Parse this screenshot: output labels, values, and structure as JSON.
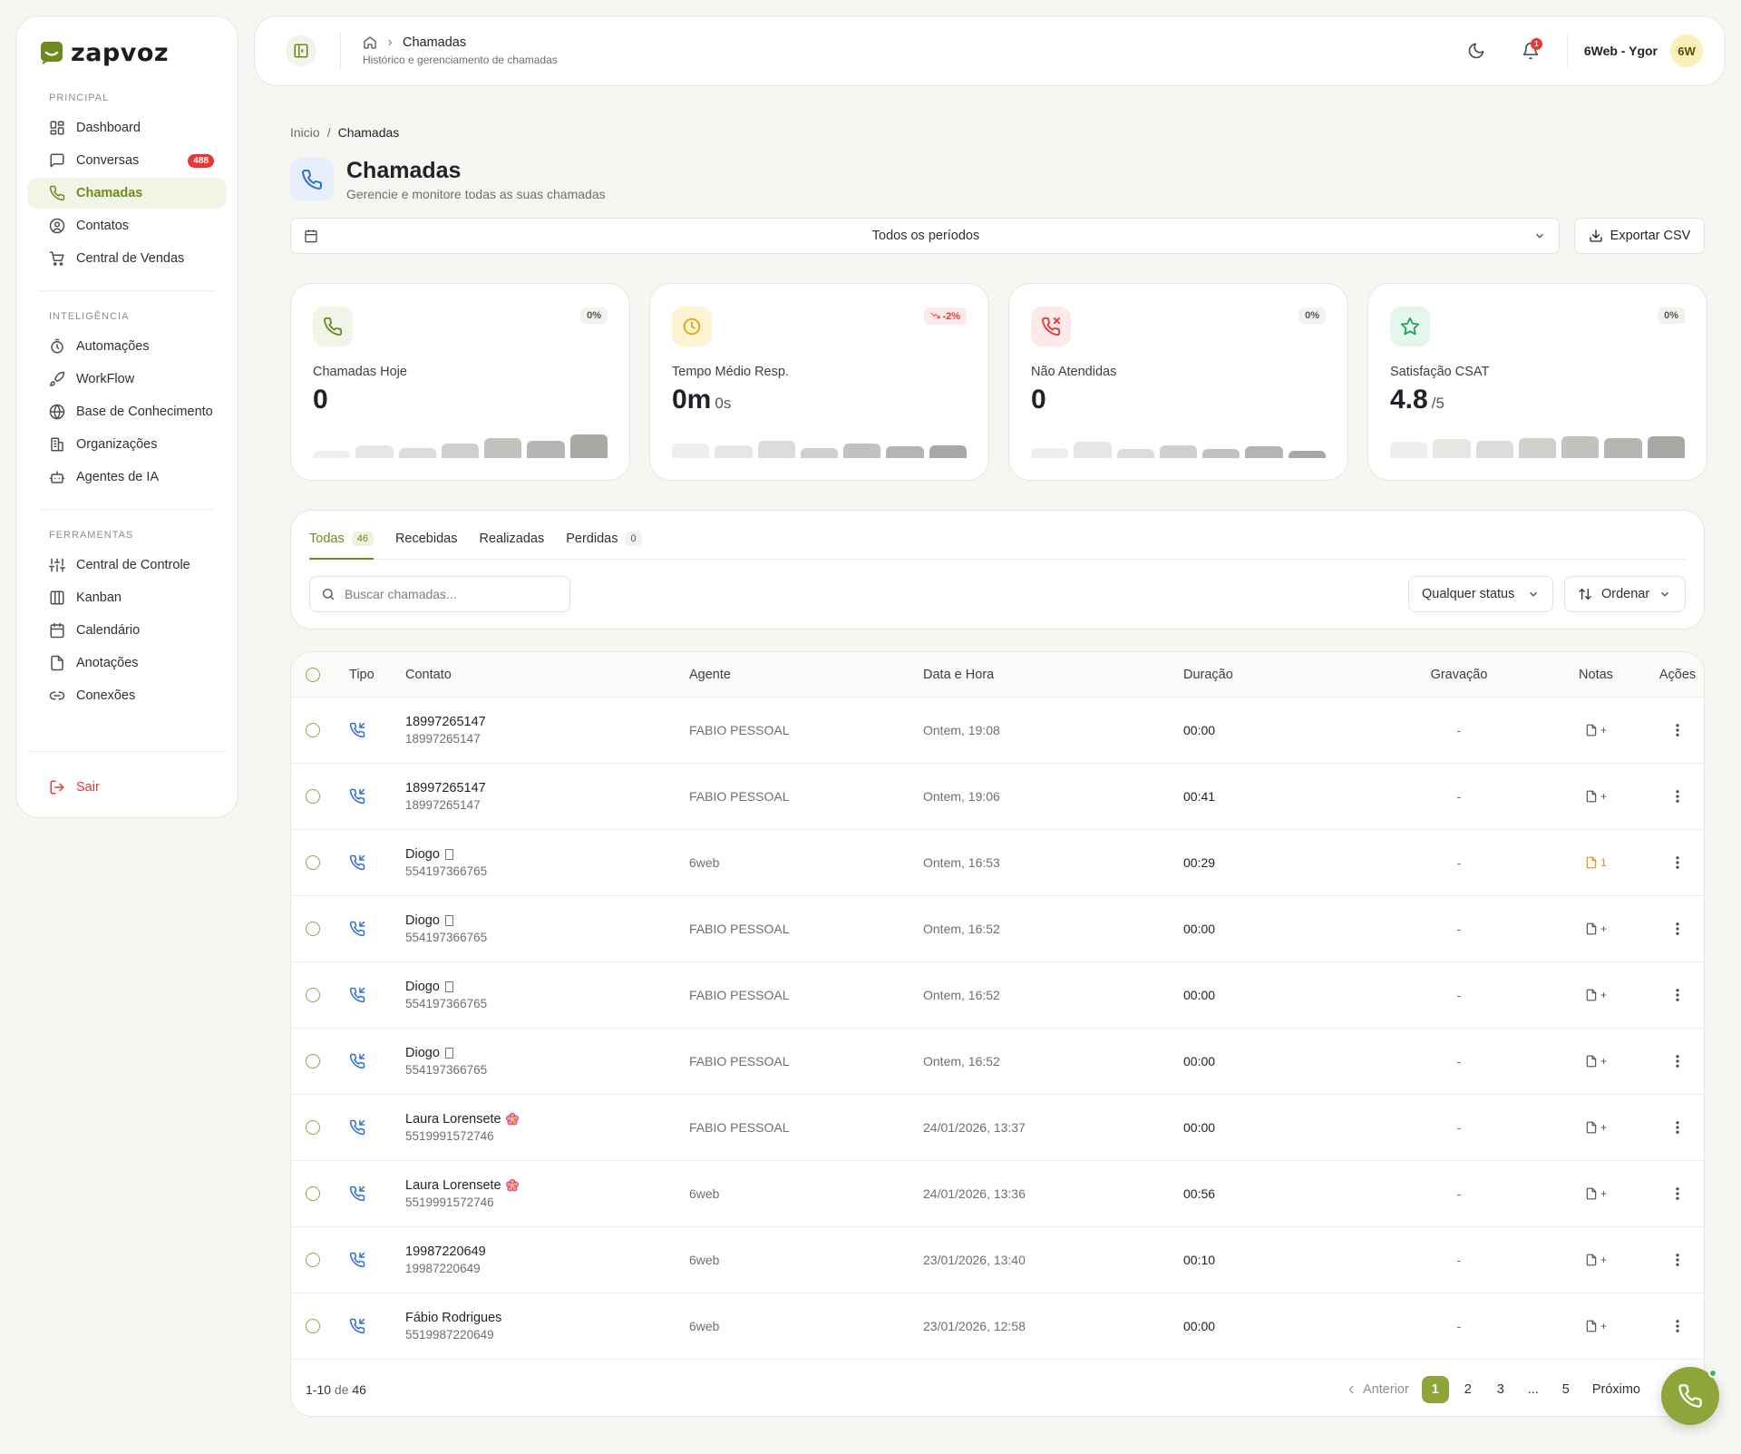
{
  "brand": {
    "name": "zapvoz",
    "color": "#6d8a1f"
  },
  "sidebar": {
    "sections": [
      {
        "label": "PRINCIPAL",
        "items": [
          {
            "label": "Dashboard",
            "icon": "dashboard-icon"
          },
          {
            "label": "Conversas",
            "icon": "chat-icon",
            "badge": "488"
          },
          {
            "label": "Chamadas",
            "icon": "phone-icon",
            "active": true
          },
          {
            "label": "Contatos",
            "icon": "user-circle-icon"
          },
          {
            "label": "Central de Vendas",
            "icon": "cart-icon"
          }
        ]
      },
      {
        "label": "INTELIGÊNCIA",
        "items": [
          {
            "label": "Automações",
            "icon": "timer-icon"
          },
          {
            "label": "WorkFlow",
            "icon": "rocket-icon"
          },
          {
            "label": "Base de Conhecimento",
            "icon": "globe-icon"
          },
          {
            "label": "Organizações",
            "icon": "building-icon"
          },
          {
            "label": "Agentes de IA",
            "icon": "bot-icon"
          }
        ]
      },
      {
        "label": "FERRAMENTAS",
        "items": [
          {
            "label": "Central de Controle",
            "icon": "sliders-icon"
          },
          {
            "label": "Kanban",
            "icon": "kanban-icon"
          },
          {
            "label": "Calendário",
            "icon": "calendar-icon"
          },
          {
            "label": "Anotações",
            "icon": "file-icon"
          },
          {
            "label": "Conexões",
            "icon": "link-icon"
          }
        ]
      }
    ],
    "logout": "Sair"
  },
  "topbar": {
    "crumb": "Chamadas",
    "subtitle": "Histórico e gerenciamento de chamadas",
    "notifications": "1",
    "user_name": "6Web - Ygor",
    "avatar": "6W"
  },
  "breadcrumb": {
    "home": "Inicio",
    "sep": "/",
    "current": "Chamadas"
  },
  "page": {
    "title": "Chamadas",
    "subtitle": "Gerencie e monitore todas as suas chamadas"
  },
  "period": {
    "value": "Todos os períodos"
  },
  "export_label": "Exportar CSV",
  "kpis": [
    {
      "label": "Chamadas Hoje",
      "value": "0",
      "suffix": "",
      "delta": "0%",
      "delta_negative": false,
      "icon": "phone-icon",
      "icon_bg": "#f1f4e8",
      "icon_color": "#6d8a1f",
      "spark": [
        0.25,
        0.45,
        0.35,
        0.5,
        0.7,
        0.6,
        0.8
      ]
    },
    {
      "label": "Tempo Médio Resp.",
      "value": "0m",
      "suffix": "0s",
      "delta": "-2%",
      "delta_negative": true,
      "icon": "clock-icon",
      "icon_bg": "#fdf4d4",
      "icon_color": "#e0a515",
      "spark": [
        0.5,
        0.45,
        0.6,
        0.35,
        0.5,
        0.4,
        0.45
      ]
    },
    {
      "label": "Não Atendidas",
      "value": "0",
      "suffix": "",
      "delta": "0%",
      "delta_negative": false,
      "icon": "phone-missed-icon",
      "icon_bg": "#fde9e9",
      "icon_color": "#e53935",
      "spark": [
        0.35,
        0.55,
        0.3,
        0.45,
        0.3,
        0.4,
        0.25
      ]
    },
    {
      "label": "Satisfação CSAT",
      "value": "4.8",
      "suffix": "/5",
      "delta": "0%",
      "delta_negative": false,
      "icon": "star-icon",
      "icon_bg": "#e5f7ec",
      "icon_color": "#22a35a",
      "spark": [
        0.55,
        0.65,
        0.6,
        0.7,
        0.75,
        0.7,
        0.75
      ]
    }
  ],
  "tabs": [
    {
      "label": "Todas",
      "count": "46",
      "active": true
    },
    {
      "label": "Recebidas",
      "count": ""
    },
    {
      "label": "Realizadas",
      "count": ""
    },
    {
      "label": "Perdidas",
      "count": "0"
    }
  ],
  "search": {
    "placeholder": "Buscar chamadas..."
  },
  "status_filter": "Qualquer status",
  "order_label": "Ordenar",
  "table": {
    "columns": [
      "Tipo",
      "Contato",
      "Agente",
      "Data e Hora",
      "Duração",
      "Gravação",
      "Notas",
      "Ações"
    ],
    "rows": [
      {
        "name": "18997265147",
        "number": "18997265147",
        "agent": "FABIO PESSOAL",
        "date": "Ontem, 19:08",
        "duration": "00:00",
        "recording": "-",
        "notes": "+",
        "has_notes": false,
        "deco": ""
      },
      {
        "name": "18997265147",
        "number": "18997265147",
        "agent": "FABIO PESSOAL",
        "date": "Ontem, 19:06",
        "duration": "00:41",
        "recording": "-",
        "notes": "+",
        "has_notes": false,
        "deco": ""
      },
      {
        "name": "Diogo",
        "number": "554197366765",
        "agent": "6web",
        "date": "Ontem, 16:53",
        "duration": "00:29",
        "recording": "-",
        "notes": "1",
        "has_notes": true,
        "deco": "glyph"
      },
      {
        "name": "Diogo",
        "number": "554197366765",
        "agent": "FABIO PESSOAL",
        "date": "Ontem, 16:52",
        "duration": "00:00",
        "recording": "-",
        "notes": "+",
        "has_notes": false,
        "deco": "glyph"
      },
      {
        "name": "Diogo",
        "number": "554197366765",
        "agent": "FABIO PESSOAL",
        "date": "Ontem, 16:52",
        "duration": "00:00",
        "recording": "-",
        "notes": "+",
        "has_notes": false,
        "deco": "glyph"
      },
      {
        "name": "Diogo",
        "number": "554197366765",
        "agent": "FABIO PESSOAL",
        "date": "Ontem, 16:52",
        "duration": "00:00",
        "recording": "-",
        "notes": "+",
        "has_notes": false,
        "deco": "glyph"
      },
      {
        "name": "Laura Lorensete",
        "number": "5519991572746",
        "agent": "FABIO PESSOAL",
        "date": "24/01/2026, 13:37",
        "duration": "00:00",
        "recording": "-",
        "notes": "+",
        "has_notes": false,
        "deco": "flower"
      },
      {
        "name": "Laura Lorensete",
        "number": "5519991572746",
        "agent": "6web",
        "date": "24/01/2026, 13:36",
        "duration": "00:56",
        "recording": "-",
        "notes": "+",
        "has_notes": false,
        "deco": "flower"
      },
      {
        "name": "19987220649",
        "number": "19987220649",
        "agent": "6web",
        "date": "23/01/2026, 13:40",
        "duration": "00:10",
        "recording": "-",
        "notes": "+",
        "has_notes": false,
        "deco": ""
      },
      {
        "name": "Fábio Rodrigues",
        "number": "5519987220649",
        "agent": "6web",
        "date": "23/01/2026, 12:58",
        "duration": "00:00",
        "recording": "-",
        "notes": "+",
        "has_notes": false,
        "deco": ""
      }
    ]
  },
  "pagination": {
    "range": "1-10",
    "of_label": "de",
    "total": "46",
    "prev": "Anterior",
    "next": "Próximo",
    "pages": [
      "1",
      "2",
      "3",
      "...",
      "5"
    ],
    "current": "1"
  }
}
